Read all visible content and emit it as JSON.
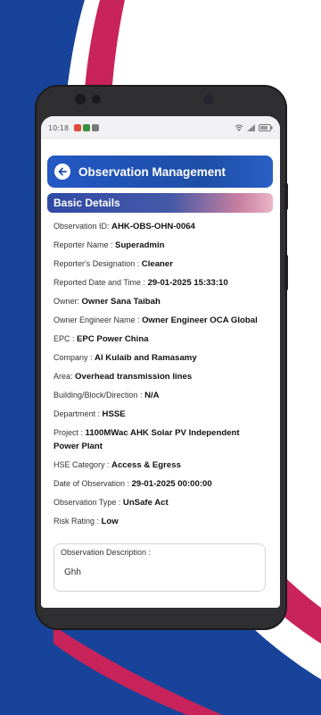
{
  "status_bar": {
    "time": "10:18"
  },
  "header": {
    "title": "Observation Management"
  },
  "section": {
    "title": "Basic Details"
  },
  "details": [
    {
      "label": "Observation ID:",
      "value": "AHK-OBS-OHN-0064"
    },
    {
      "label": "Reporter Name :",
      "value": "Superadmin"
    },
    {
      "label": "Reporter's Designation :",
      "value": "Cleaner"
    },
    {
      "label": "Reported Date and Time :",
      "value": "29-01-2025 15:33:10"
    },
    {
      "label": "Owner:",
      "value": "Owner Sana Taibah"
    },
    {
      "label": "Owner Engineer Name :",
      "value": "Owner Engineer OCA Global"
    },
    {
      "label": "EPC :",
      "value": "EPC Power China"
    },
    {
      "label": "Company :",
      "value": "Al Kulaib and Ramasamy"
    },
    {
      "label": "Area:",
      "value": "Overhead transmission lines"
    },
    {
      "label": "Building/Block/Direction :",
      "value": "N/A"
    },
    {
      "label": "Department :",
      "value": "HSSE"
    },
    {
      "label": "Project :",
      "value": "1100MWac AHK Solar PV Independent Power Plant"
    },
    {
      "label": "HSE Category :",
      "value": "Access & Egress"
    },
    {
      "label": "Date of Observation :",
      "value": "29-01-2025 00:00:00"
    },
    {
      "label": "Observation Type :",
      "value": "UnSafe Act"
    },
    {
      "label": "Risk Rating :",
      "value": "Low"
    }
  ],
  "description": {
    "label": "Observation Description :",
    "value": "Ghh"
  },
  "colors": {
    "brand_blue": "#1e4ea8",
    "brand_red": "#c8235a"
  }
}
